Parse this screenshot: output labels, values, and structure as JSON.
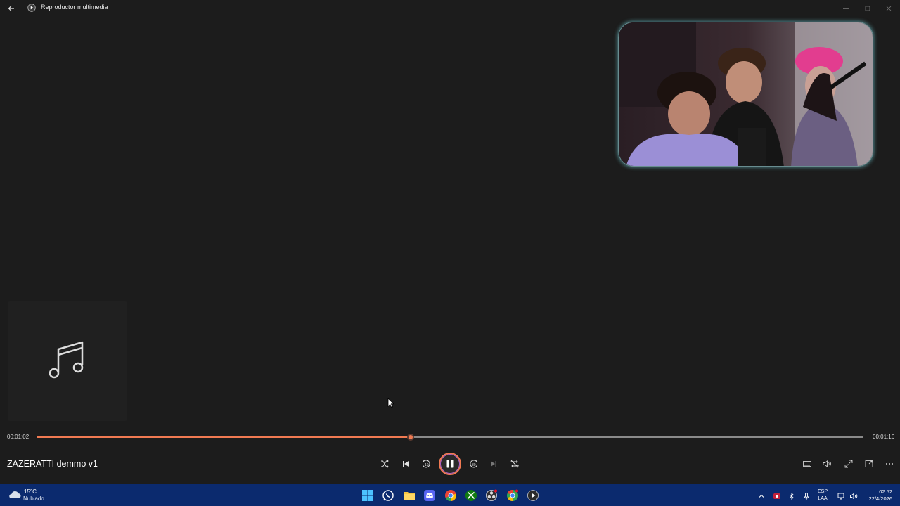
{
  "window": {
    "title": "Reproductor multimedia"
  },
  "player": {
    "track_title": "ZAZERATTI demmo v1",
    "time_elapsed": "00:01:02",
    "time_total": "00:01:16",
    "progress": 0.452,
    "state": "playing"
  },
  "taskbar": {
    "weather_temp": "15°C",
    "weather_condition": "Nublado",
    "lang_line1": "ESP",
    "lang_line2": "LAA",
    "clock_time": "02:52",
    "clock_date": "22/4/2026"
  },
  "colors": {
    "background": "#1c1c1c",
    "accent": "#f07a52",
    "taskbar": "#0b2a6e"
  },
  "icons": {
    "back": "back-arrow-icon",
    "app": "media-player-icon",
    "album_placeholder": "music-note-icon",
    "shuffle": "shuffle-icon",
    "previous": "previous-icon",
    "rewind": "rewind-10-icon",
    "pause": "pause-icon",
    "forward": "forward-30-icon",
    "next": "next-icon",
    "repeat": "repeat-off-icon"
  }
}
